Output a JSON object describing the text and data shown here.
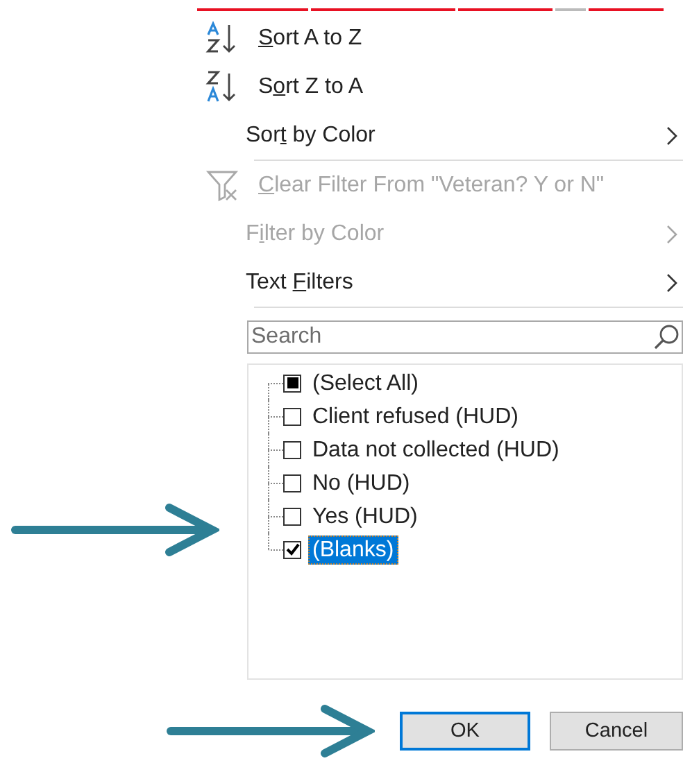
{
  "menu_items": [
    {
      "kind": "sort-ascending",
      "access_key": "S",
      "label_after": "ort A to Z",
      "disabled": false,
      "submenu": false,
      "separator_after": false
    },
    {
      "kind": "sort-descending",
      "label_before": "S",
      "access_key": "o",
      "label_after": "rt Z to A",
      "disabled": false,
      "submenu": false,
      "separator_after": false
    },
    {
      "kind": "plain",
      "label_before": "Sor",
      "access_key": "t",
      "label_after": " by Color",
      "disabled": false,
      "submenu": true,
      "separator_after": true
    },
    {
      "kind": "clear-filter",
      "access_key": "C",
      "label_after": "lear Filter From \"Veteran? Y or N\"",
      "disabled": true,
      "submenu": false,
      "separator_after": false
    },
    {
      "kind": "plain",
      "label_before": "F",
      "access_key": "i",
      "label_after": "lter by Color",
      "disabled": true,
      "submenu": true,
      "separator_after": false
    },
    {
      "kind": "plain",
      "label_before": "Text ",
      "access_key": "F",
      "label_after": "ilters",
      "disabled": false,
      "submenu": true,
      "separator_after": true
    }
  ],
  "search": {
    "placeholder": "Search"
  },
  "values": [
    {
      "label": "(Select All)",
      "checked": false,
      "partial": true,
      "selected": false
    },
    {
      "label": "Client refused (HUD)",
      "checked": false,
      "partial": false,
      "selected": false
    },
    {
      "label": "Data not collected (HUD)",
      "checked": false,
      "partial": false,
      "selected": false
    },
    {
      "label": "No (HUD)",
      "checked": false,
      "partial": false,
      "selected": false
    },
    {
      "label": "Yes (HUD)",
      "checked": false,
      "partial": false,
      "selected": false
    },
    {
      "label": "(Blanks)",
      "checked": true,
      "partial": false,
      "selected": true
    }
  ],
  "buttons": [
    {
      "label": "OK",
      "default": true
    },
    {
      "label": "Cancel",
      "default": false
    }
  ]
}
